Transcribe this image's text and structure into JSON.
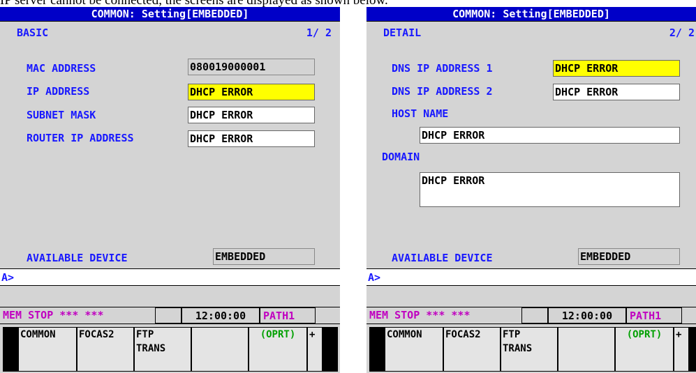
{
  "caption": "IP server cannot be connected, the screens are displayed as shown below.",
  "screens": [
    {
      "title": "COMMON: Setting[EMBEDDED]",
      "section": "BASIC",
      "page": "1/ 2",
      "fields": [
        {
          "label": "MAC ADDRESS",
          "value": "080019000001"
        },
        {
          "label": "IP ADDRESS",
          "value": "DHCP ERROR"
        },
        {
          "label": "SUBNET MASK",
          "value": "DHCP ERROR"
        },
        {
          "label": "ROUTER IP ADDRESS",
          "value": "DHCP ERROR"
        }
      ],
      "device_label": "AVAILABLE DEVICE",
      "device_value": "EMBEDDED",
      "prompt": "A>",
      "status": {
        "mode": "MEM  STOP *** ***",
        "time": "12:00:00",
        "path": "PATH1"
      },
      "softkeys": [
        "COMMON",
        "FOCAS2",
        "FTP\nTRANS",
        "",
        "(OPRT)",
        "+"
      ]
    },
    {
      "title": "COMMON: Setting[EMBEDDED]",
      "section": "DETAIL",
      "page": "2/ 2",
      "fields": [
        {
          "label": "DNS IP ADDRESS 1",
          "value": "DHCP ERROR"
        },
        {
          "label": "DNS IP ADDRESS 2",
          "value": "DHCP ERROR"
        },
        {
          "label": "HOST NAME",
          "value": "DHCP ERROR"
        },
        {
          "label": "DOMAIN",
          "value": "DHCP ERROR"
        }
      ],
      "device_label": "AVAILABLE DEVICE",
      "device_value": "EMBEDDED",
      "prompt": "A>",
      "status": {
        "mode": "MEM  STOP *** ***",
        "time": "12:00:00",
        "path": "PATH1"
      },
      "softkeys": [
        "COMMON",
        "FOCAS2",
        "FTP\nTRANS",
        "",
        "(OPRT)",
        "+"
      ]
    }
  ],
  "colors": {
    "title_bar": "#0000c8",
    "label": "#1818ff",
    "highlight": "#ffff00",
    "status_mode": "#c000c0",
    "oprt": "#00a000"
  }
}
